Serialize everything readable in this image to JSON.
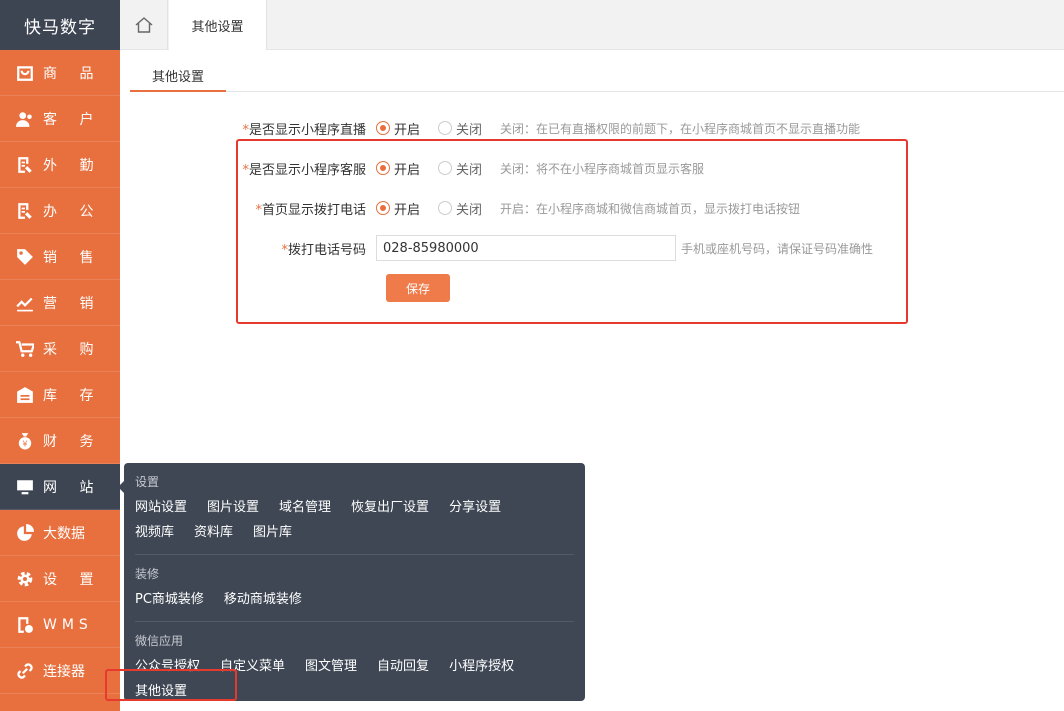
{
  "brand": "快马数字",
  "sidebar": {
    "items": [
      {
        "label": "商 品",
        "icon": "bag-icon"
      },
      {
        "label": "客 户",
        "icon": "users-icon"
      },
      {
        "label": "外 勤",
        "icon": "doc-edit-icon"
      },
      {
        "label": "办 公",
        "icon": "doc-edit-icon"
      },
      {
        "label": "销 售",
        "icon": "tag-icon"
      },
      {
        "label": "营 销",
        "icon": "chart-icon"
      },
      {
        "label": "采 购",
        "icon": "cart-icon"
      },
      {
        "label": "库 存",
        "icon": "warehouse-icon"
      },
      {
        "label": "财 务",
        "icon": "moneybag-icon"
      },
      {
        "label": "网 站",
        "icon": "monitor-icon"
      },
      {
        "label": "大数据",
        "icon": "pie-icon"
      },
      {
        "label": "设 置",
        "icon": "gear-icon"
      },
      {
        "label": "WMS",
        "icon": "wms-icon"
      },
      {
        "label": "连接器",
        "icon": "link-icon"
      }
    ]
  },
  "topbar": {
    "tab": "其他设置"
  },
  "subtabs": {
    "active": "其他设置"
  },
  "form": {
    "live": {
      "label": "是否显示小程序直播",
      "on": "开启",
      "off": "关闭",
      "hint": "关闭：在已有直播权限的前题下，在小程序商城首页不显示直播功能"
    },
    "service": {
      "label": "是否显示小程序客服",
      "on": "开启",
      "off": "关闭",
      "hint": "关闭：将不在小程序商城首页显示客服"
    },
    "call": {
      "label": "首页显示拨打电话",
      "on": "开启",
      "off": "关闭",
      "hint": "开启：在小程序商城和微信商城首页，显示拨打电话按钮"
    },
    "phone": {
      "label": "拨打电话号码",
      "value": "028-85980000",
      "hint": "手机或座机号码，请保证号码准确性"
    },
    "save": "保存"
  },
  "popup": {
    "groups": [
      {
        "title": "设置",
        "links": [
          "网站设置",
          "图片设置",
          "域名管理",
          "恢复出厂设置",
          "分享设置",
          "视频库",
          "资料库",
          "图片库"
        ]
      },
      {
        "title": "装修",
        "links": [
          "PC商城装修",
          "移动商城装修"
        ]
      },
      {
        "title": "微信应用",
        "links": [
          "公众号授权",
          "自定义菜单",
          "图文管理",
          "自动回复",
          "小程序授权",
          "其他设置"
        ]
      }
    ]
  },
  "colors": {
    "accent": "#e8703f",
    "dark": "#3d4452",
    "highlight": "#e53a2d"
  }
}
